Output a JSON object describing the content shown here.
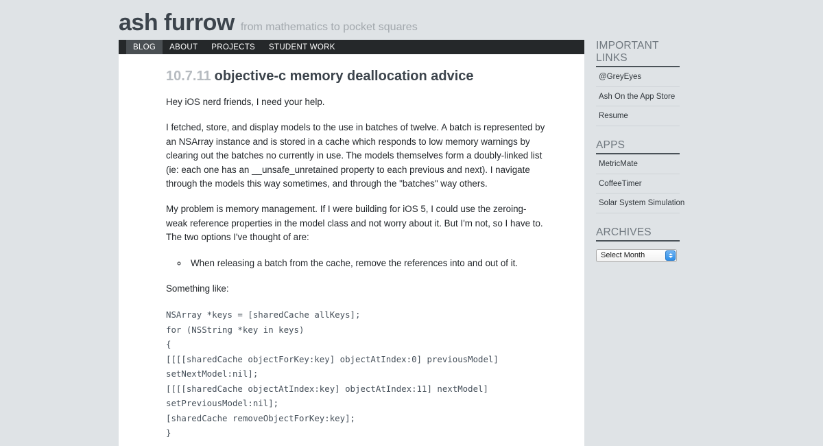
{
  "site": {
    "title": "ash furrow",
    "tagline": "from mathematics to pocket squares"
  },
  "nav": {
    "items": [
      {
        "label": "BLOG",
        "active": true
      },
      {
        "label": "ABOUT",
        "active": false
      },
      {
        "label": "PROJECTS",
        "active": false
      },
      {
        "label": "STUDENT WORK",
        "active": false
      }
    ]
  },
  "post": {
    "date": "10.7.11",
    "title": "objective-c memory deallocation advice",
    "paragraphs": [
      "Hey iOS nerd friends, I need your help.",
      "I fetched, store, and display models to the use in batches of twelve. A batch is represented by an NSArray instance and is stored in a cache which responds to low memory warnings by clearing out the batches no currently in use. The models themselves form a doubly-linked list (ie: each one has an __unsafe_unretained property to each previous and next). I navigate through the models this way sometimes, and through the \"batches\" way others.",
      "My problem is memory management. If I were building for iOS 5, I could use the zeroing-weak reference properties in the model class and not worry about it. But I'm not, so I have to. The two options I've thought of are:"
    ],
    "list_items": [
      "When releasing a batch from the cache, remove the references into and out of it."
    ],
    "after_list_paragraph": "Something like:",
    "code": "NSArray *keys = [sharedCache allKeys];\nfor (NSString *key in keys)\n{\n[[[[sharedCache objectForKey:key] objectAtIndex:0] previousModel] setNextModel:nil];\n[[[[sharedCache objectAtIndex:key] objectAtIndex:11] nextModel] setPreviousModel:nil];\n[sharedCache removeObjectForKey:key];\n}"
  },
  "sidebar": {
    "blocks": [
      {
        "heading": "IMPORTANT LINKS",
        "links": [
          "@GreyEyes",
          "Ash On the App Store",
          "Resume"
        ]
      },
      {
        "heading": "APPS",
        "links": [
          "MetricMate",
          "CoffeeTimer",
          "Solar System Simulation"
        ]
      }
    ],
    "archives": {
      "heading": "ARCHIVES",
      "select_value": "Select Month",
      "options": [
        "Select Month"
      ]
    }
  },
  "colors": {
    "page_background": "#dfe3e6",
    "content_background": "#ffffff",
    "nav_background": "#25282a",
    "nav_active_background": "#4a4f53",
    "title_color": "#3c444c",
    "date_color": "#b6bbc0",
    "tagline_color": "#a2a8ad",
    "code_color": "#46505a",
    "sidebar_heading_color": "#70787f",
    "sidebar_rule_color": "#4a5258",
    "stepper_blue": "#2f8fe8"
  }
}
